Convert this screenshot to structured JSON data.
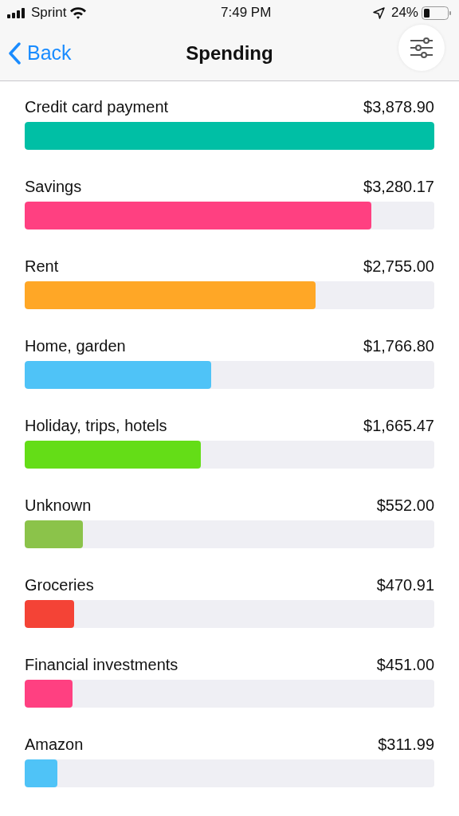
{
  "status_bar": {
    "carrier": "Sprint",
    "time": "7:49 PM",
    "battery": "24%"
  },
  "nav": {
    "back": "Back",
    "title": "Spending"
  },
  "categories": [
    {
      "name": "Credit card payment",
      "amount": "$3,878.90",
      "level": 1.0,
      "color": "#00bfa5"
    },
    {
      "name": "Savings",
      "amount": "$3,280.17",
      "level": 0.846,
      "color": "#ff4081"
    },
    {
      "name": "Rent",
      "amount": "$2,755.00",
      "level": 0.711,
      "color": "#ffa726"
    },
    {
      "name": "Home, garden",
      "amount": "$1,766.80",
      "level": 0.455,
      "color": "#4fc3f7"
    },
    {
      "name": "Holiday, trips, hotels",
      "amount": "$1,665.47",
      "level": 0.43,
      "color": "#64dd17"
    },
    {
      "name": "Unknown",
      "amount": "$552.00",
      "level": 0.142,
      "color": "#8bc34a"
    },
    {
      "name": "Groceries",
      "amount": "$470.91",
      "level": 0.121,
      "color": "#f44336"
    },
    {
      "name": "Financial investments",
      "amount": "$451.00",
      "level": 0.116,
      "color": "#ff4081"
    },
    {
      "name": "Amazon",
      "amount": "$311.99",
      "level": 0.08,
      "color": "#4fc3f7"
    }
  ]
}
